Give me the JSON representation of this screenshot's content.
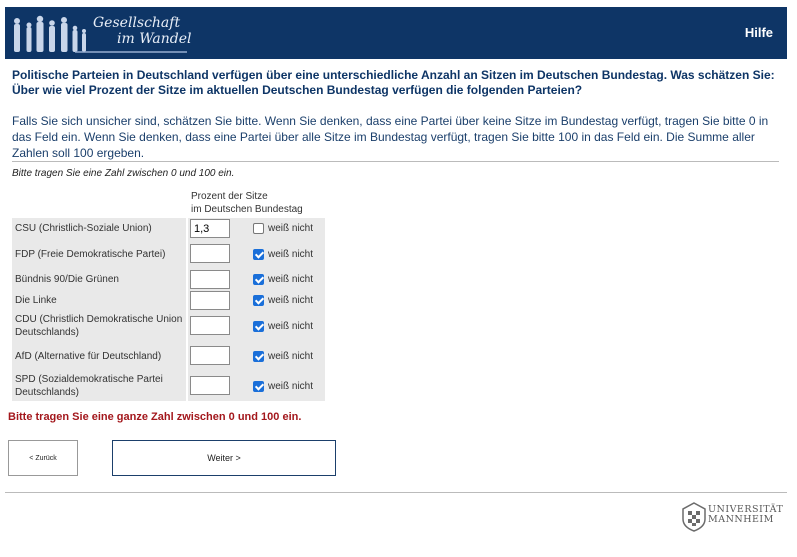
{
  "header": {
    "logo_line1": "Gesellschaft",
    "logo_line2": "im Wandel",
    "help_label": "Hilfe"
  },
  "question": {
    "line1": "Politische Parteien in Deutschland verfügen über eine unterschiedliche Anzahl an Sitzen im Deutschen Bundestag. Was schätzen Sie:",
    "line2": "Über wie viel Prozent der Sitze im aktuellen Deutschen Bundestag verfügen die folgenden Parteien?"
  },
  "instructions": "Falls Sie sich unsicher sind, schätzen Sie bitte. Wenn Sie denken, dass eine Partei über keine Sitze im Bundestag verfügt, tragen Sie bitte 0 in das Feld ein. Wenn Sie denken, dass eine Partei über alle Sitze im Bundestag verfügt, tragen Sie bitte 100 in das Feld ein. Die Summe aller Zahlen soll 100 ergeben.",
  "hint": "Bitte tragen Sie eine Zahl zwischen 0 und 100 ein.",
  "column_header": {
    "line1": "Prozent der Sitze",
    "line2": "im Deutschen Bundestag"
  },
  "dont_know_label": "weiß nicht",
  "parties": [
    {
      "label": "CSU (Christlich-Soziale Union)",
      "value": "1,3",
      "dont_know": false
    },
    {
      "label": "FDP (Freie Demokratische Partei)",
      "value": "",
      "dont_know": true
    },
    {
      "label": "Bündnis 90/Die Grünen",
      "value": "",
      "dont_know": true
    },
    {
      "label": "Die Linke",
      "value": "",
      "dont_know": true
    },
    {
      "label": "CDU (Christlich Demokratische Union Deutschlands)",
      "value": "",
      "dont_know": true
    },
    {
      "label": "AfD (Alternative für Deutschland)",
      "value": "",
      "dont_know": true
    },
    {
      "label": "SPD (Sozialdemokratische Partei Deutschlands)",
      "value": "",
      "dont_know": true
    }
  ],
  "error_message": "Bitte tragen Sie eine ganze Zahl zwischen 0 und 100 ein.",
  "buttons": {
    "back": "< Zurück",
    "next": "Weiter >"
  },
  "footer": {
    "university_line1": "UNIVERSITÄT",
    "university_line2": "MANNHEIM"
  }
}
